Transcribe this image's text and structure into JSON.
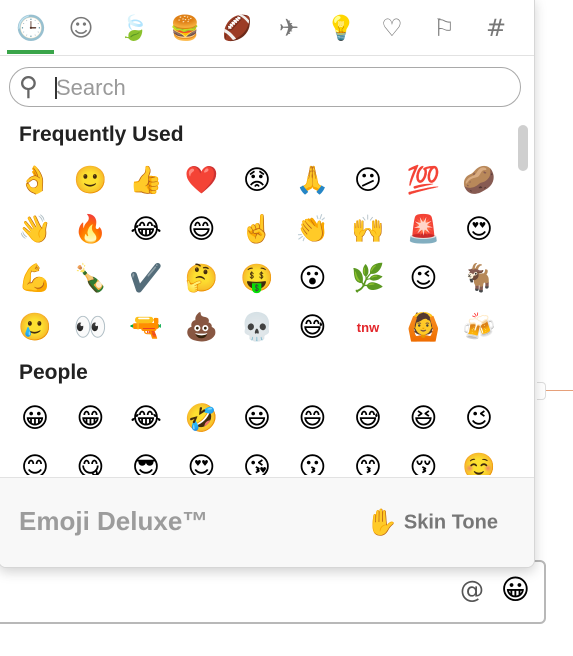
{
  "tabs": [
    {
      "icon": "clock-icon",
      "glyph": "🕒"
    },
    {
      "icon": "smiley-icon",
      "glyph": "☺"
    },
    {
      "icon": "leaf-icon",
      "glyph": "🍃"
    },
    {
      "icon": "burger-icon",
      "glyph": "🍔"
    },
    {
      "icon": "football-icon",
      "glyph": "🏈"
    },
    {
      "icon": "airplane-icon",
      "glyph": "✈"
    },
    {
      "icon": "lightbulb-icon",
      "glyph": "💡"
    },
    {
      "icon": "heart-icon",
      "glyph": "♡"
    },
    {
      "icon": "flag-icon",
      "glyph": "⚐"
    },
    {
      "icon": "hashtag-icon",
      "glyph": "#"
    }
  ],
  "search": {
    "placeholder": "Search",
    "value": ""
  },
  "sections": [
    {
      "title": "Frequently Used",
      "rows": [
        [
          "👌",
          "🙂",
          "👍",
          "❤️",
          "😟",
          "🙏",
          "😕",
          "💯",
          "🥔"
        ],
        [
          "👋",
          "🔥",
          "😂",
          "😄",
          "☝️",
          "👏",
          "🙌",
          "🚨",
          "😍"
        ],
        [
          "💪",
          "🍾",
          "✔️",
          "🤔",
          "🤑",
          "😮",
          "🌿",
          "😉",
          "🐐"
        ],
        [
          "🥲",
          "👀",
          "🔫",
          "💩",
          "💀",
          "😅",
          "tnw",
          "🙆",
          "🍻"
        ]
      ]
    },
    {
      "title": "People",
      "rows": [
        [
          "😀",
          "😁",
          "😂",
          "🤣",
          "😃",
          "😄",
          "😅",
          "😆",
          "😉"
        ],
        [
          "😊",
          "😋",
          "😎",
          "😍",
          "😘",
          "😗",
          "😙",
          "😚",
          "☺️"
        ]
      ]
    }
  ],
  "footer": {
    "title": "Emoji Deluxe™",
    "skin_tone_label": "Skin Tone",
    "skin_tone_glyph": "✋"
  },
  "input": {
    "at_symbol": "@",
    "emoji_glyph": "😀"
  }
}
